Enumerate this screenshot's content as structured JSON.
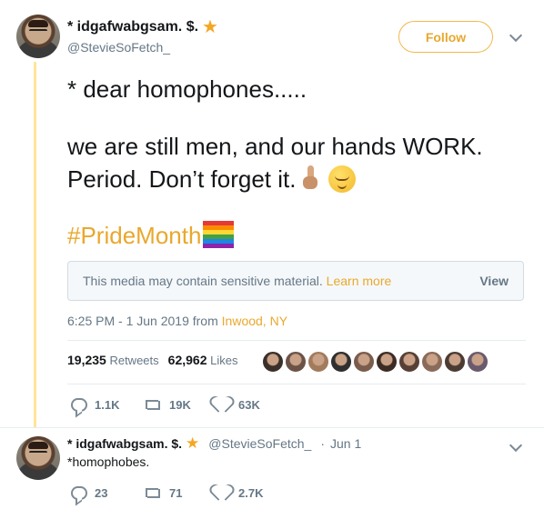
{
  "tweet": {
    "display_name": "* idgafwabgsam. $.",
    "handle": "@StevieSoFetch_",
    "follow_label": "Follow",
    "line1": "* dear homophones.....",
    "line2": "we are still men, and our hands WORK.",
    "line3": "Period.  Don’t forget it.",
    "hashtag": "#PrideMonth",
    "sensitive": {
      "message": "This media may contain sensitive material.",
      "learn_more": "Learn more",
      "view_label": "View"
    },
    "time": "6:25 PM - 1 Jun 2019 from",
    "location": "Inwood, NY",
    "retweets_count": "19,235",
    "retweets_label": "Retweets",
    "likes_count": "62,962",
    "likes_label": "Likes",
    "likers_colors": [
      "#3b2f2a",
      "#6b5347",
      "#a27b5c",
      "#2f2f2f",
      "#7a5c4d",
      "#3d2c24",
      "#564036",
      "#8a6a58",
      "#4b3b33",
      "#6a5a6e"
    ],
    "actions": {
      "replies": "1.1K",
      "retweets": "19K",
      "likes": "63K"
    }
  },
  "reply": {
    "display_name": "* idgafwabgsam. $.",
    "handle": "@StevieSoFetch_",
    "separator": "·",
    "date": "Jun 1",
    "text": "*homophobes.",
    "actions": {
      "replies": "23",
      "retweets": "71",
      "likes": "2.7K"
    }
  },
  "colors": {
    "accent": "#e9a82d",
    "thread_line": "#ffe49a",
    "muted": "#657786"
  }
}
